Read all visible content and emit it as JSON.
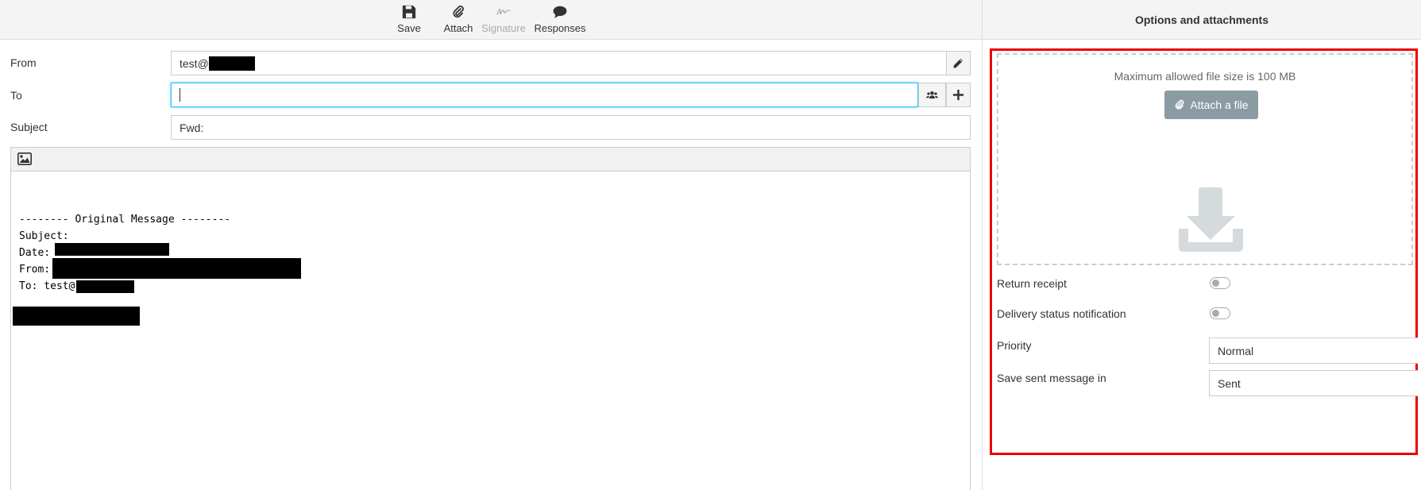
{
  "toolbar": {
    "save_label": "Save",
    "attach_label": "Attach",
    "signature_label": "Signature",
    "responses_label": "Responses"
  },
  "compose": {
    "from_label": "From",
    "from_value": "test@",
    "to_label": "To",
    "to_value": "",
    "subject_label": "Subject",
    "subject_value": "Fwd:"
  },
  "body": {
    "header_line": "-------- Original Message --------",
    "subject_line": "Subject:",
    "date_line": "Date: ",
    "from_line": "From: ",
    "to_line": "To: test@"
  },
  "options_panel": {
    "title": "Options and attachments",
    "max_size_text": "Maximum allowed file size is 100 MB",
    "attach_button": "Attach a file",
    "return_receipt_label": "Return receipt",
    "return_receipt_on": false,
    "dsn_label": "Delivery status notification",
    "dsn_on": false,
    "priority_label": "Priority",
    "priority_value": "Normal",
    "save_sent_label": "Save sent message in",
    "save_sent_value": "Sent"
  },
  "colors": {
    "highlight_border": "#e00000",
    "focus_border": "#37beff",
    "attach_button_bg": "#8a9ba4"
  }
}
